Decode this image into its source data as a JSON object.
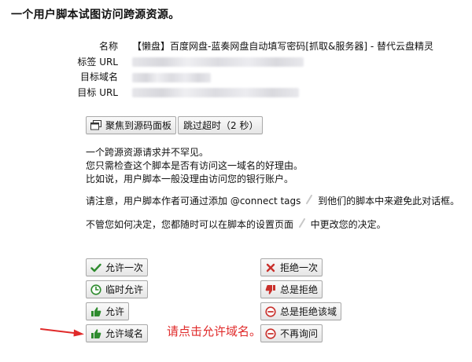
{
  "page": {
    "title": "一个用户脚本试图访问跨源资源。"
  },
  "info": {
    "name_label": "名称",
    "name_value": "【懒盘】百度网盘-蓝奏网盘自动填写密码[抓取&服务器] - 替代云盘精灵",
    "tag_url_label": "标签 URL",
    "target_domain_label": "目标域名",
    "target_url_label": "目标 URL"
  },
  "toolbar": {
    "focus_source_label": "聚焦到源码面板",
    "skip_timeout_label": "跳过超时（2 秒）"
  },
  "message": {
    "line1": "一个跨源资源请求并不罕见。",
    "line2": "您只需检查这个脚本是否有访问这一域名的好理由。",
    "line3": "比如说，用户脚本一般没理由访问您的银行账户。",
    "line4_part1": "请注意，用户脚本作者可通过添加 @connect tags",
    "line4_part2": "到他们的脚本中来避免此对话框。",
    "line5_part1": "不管您如何决定，您都随时可以在脚本的设置页面",
    "line5_part2": "中更改您的决定。"
  },
  "actions": {
    "allow_once": "允许一次",
    "temp_allow": "临时允许",
    "allow": "允许",
    "allow_domain": "允许域名",
    "deny_once": "拒绝一次",
    "always_deny": "总是拒绝",
    "always_deny_domain": "总是拒绝该域",
    "never_ask": "不再询问"
  },
  "annotation": {
    "text": "请点击允许域名。"
  },
  "colors": {
    "allow_green": "#2e8b2e",
    "deny_red": "#c9302c",
    "annotation_red": "#e02a2a",
    "button_border": "#a9a9a9",
    "pencil_gray": "#c8c8c8"
  },
  "icons": {
    "focus_source": "window-icon",
    "allow_once": "checkmark-icon",
    "temp_allow": "clock-icon",
    "allow": "thumbs-up-icon",
    "allow_domain": "thumbs-up-icon",
    "deny_once": "cross-icon",
    "always_deny": "thumbs-down-icon",
    "always_deny_domain": "minus-circle-icon",
    "never_ask": "minus-circle-icon",
    "edit": "pencil-icon"
  }
}
